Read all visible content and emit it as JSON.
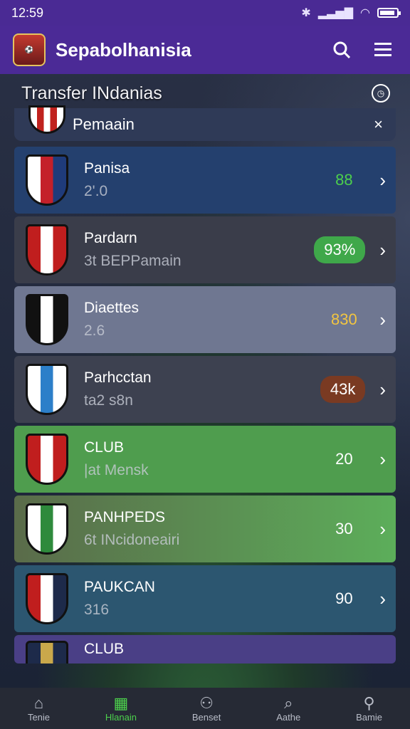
{
  "status": {
    "time": "12:59"
  },
  "app": {
    "title": "Sepabolhanisia"
  },
  "section": {
    "title": "Transfer INdanias"
  },
  "filter": {
    "label": "Pemaain",
    "close": "×"
  },
  "rows": [
    {
      "name": "Panisa",
      "sub": "2'.0",
      "value": "88",
      "bg": "#24406e",
      "valueColor": "#4cd04c",
      "pill": "",
      "crest": [
        "#ffffff",
        "#c4202a",
        "#1f3b7a"
      ]
    },
    {
      "name": "Pardarn",
      "sub": "3t BEPPamain",
      "value": "93%",
      "bg": "#3a3d4a",
      "valueColor": "#ffffff",
      "pill": "#3fa84a",
      "crest": [
        "#c01e1e",
        "#ffffff",
        "#c01e1e"
      ]
    },
    {
      "name": "Diaettes",
      "sub": "2.6",
      "value": "830",
      "bg": "#6f7791",
      "valueColor": "#f2c541",
      "pill": "",
      "crest": [
        "#111111",
        "#ffffff",
        "#111111"
      ]
    },
    {
      "name": "Parhcctan",
      "sub": "ta2 s8n",
      "value": "43k",
      "bg": "#3d4150",
      "valueColor": "#ffffff",
      "pill": "#7a3a22",
      "crest": [
        "#ffffff",
        "#2c7fc9",
        "#ffffff"
      ]
    },
    {
      "name": "CLUB",
      "sub": "|at Mensk",
      "value": "20",
      "bg": "#4f9d4e",
      "valueColor": "#ffffff",
      "pill": "",
      "crest": [
        "#c01e1e",
        "#ffffff",
        "#c01e1e"
      ]
    },
    {
      "name": "PANHPEDS",
      "sub": "6t INcidoneairi",
      "value": "30",
      "bg": "linear-gradient(90deg,#5a6b4a,#5cae5a)",
      "valueColor": "#ffffff",
      "pill": "",
      "crest": [
        "#ffffff",
        "#2e8a3c",
        "#ffffff"
      ]
    },
    {
      "name": "PAUKCAN",
      "sub": "316",
      "value": "90",
      "bg": "#2c5670",
      "valueColor": "#ffffff",
      "pill": "",
      "crest": [
        "#c01e1e",
        "#ffffff",
        "#1d2a4a"
      ]
    },
    {
      "name": "CLUB",
      "sub": "",
      "value": "",
      "bg": "#4a3f86",
      "valueColor": "#ffffff",
      "pill": "",
      "crest": [
        "#1d2a4a",
        "#c9a84b",
        "#1d2a4a"
      ]
    }
  ],
  "nav": [
    {
      "label": "Tenie",
      "icon": "home-icon",
      "glyph": "⌂"
    },
    {
      "label": "Hlanain",
      "icon": "stadium-icon",
      "glyph": "▦"
    },
    {
      "label": "Benset",
      "icon": "scout-icon",
      "glyph": "⚇"
    },
    {
      "label": "Aathe",
      "icon": "search-icon",
      "glyph": "⌕"
    },
    {
      "label": "Bamie",
      "icon": "profile-icon",
      "glyph": "⚲"
    }
  ]
}
